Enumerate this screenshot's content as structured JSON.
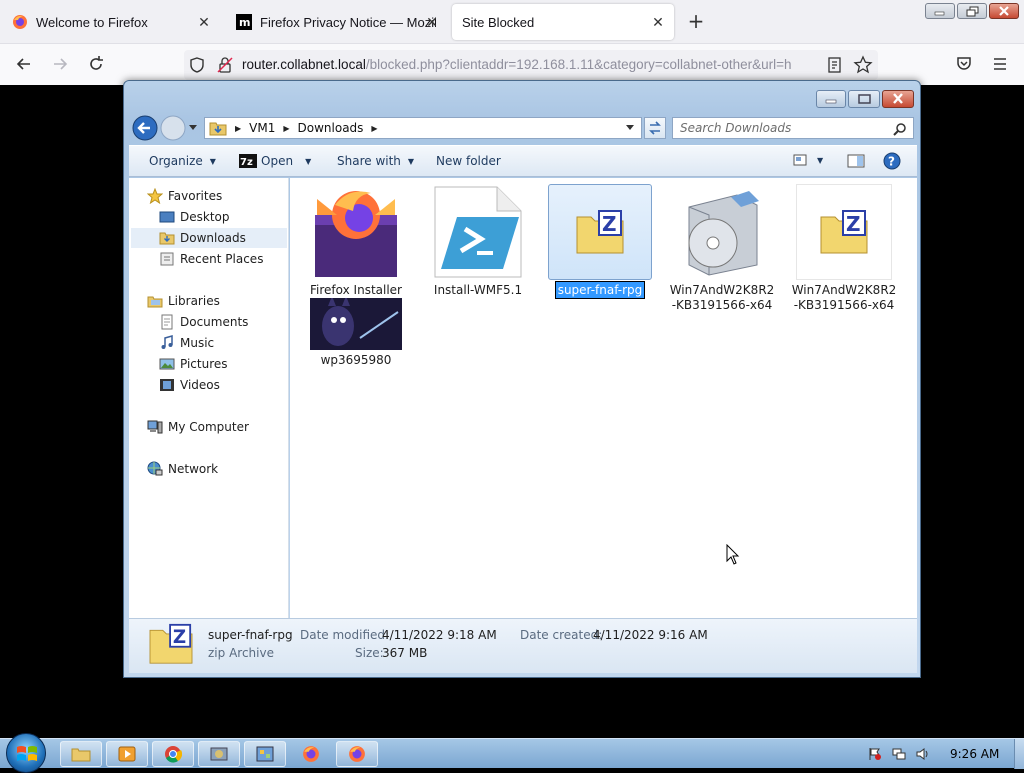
{
  "browser": {
    "tabs": [
      {
        "title": "Welcome to Firefox",
        "active": false
      },
      {
        "title": "Firefox Privacy Notice — Mozilla",
        "active": false
      },
      {
        "title": "Site Blocked",
        "active": true
      }
    ],
    "url": {
      "host": "router.collabnet.local",
      "rest": "/blocked.php?clientaddr=192.168.1.11&category=collabnet-other&url=h"
    }
  },
  "explorer": {
    "breadcrumb": [
      "VM1",
      "Downloads"
    ],
    "search_placeholder": "Search Downloads",
    "commands": {
      "organize": "Organize",
      "open": "Open",
      "share_with": "Share with",
      "new_folder": "New folder"
    },
    "nav": {
      "favorites": "Favorites",
      "desktop": "Desktop",
      "downloads": "Downloads",
      "recent_places": "Recent Places",
      "libraries": "Libraries",
      "documents": "Documents",
      "music": "Music",
      "pictures": "Pictures",
      "videos": "Videos",
      "my_computer": "My Computer",
      "network": "Network"
    },
    "files": [
      {
        "name": "Firefox Installer",
        "icon": "firefox-installer-icon"
      },
      {
        "name": "Install-WMF5.1",
        "icon": "powershell-icon"
      },
      {
        "name": "super-fnaf-rpg",
        "icon": "zip-folder-icon",
        "selected": true
      },
      {
        "name": "Win7AndW2K8R2-KB3191566-x64",
        "icon": "installer-cd-icon"
      },
      {
        "name": "Win7AndW2K8R2-KB3191566-x64",
        "icon": "zip-folder-icon"
      },
      {
        "name": "wp3695980",
        "icon": "image-thumbnail"
      }
    ],
    "details": {
      "name": "super-fnaf-rpg",
      "type": "zip Archive",
      "date_modified_label": "Date modified:",
      "date_modified": "4/11/2022 9:18 AM",
      "date_created_label": "Date created:",
      "date_created": "4/11/2022 9:16 AM",
      "size_label": "Size:",
      "size": "367 MB"
    }
  },
  "taskbar": {
    "clock": "9:26 AM"
  }
}
